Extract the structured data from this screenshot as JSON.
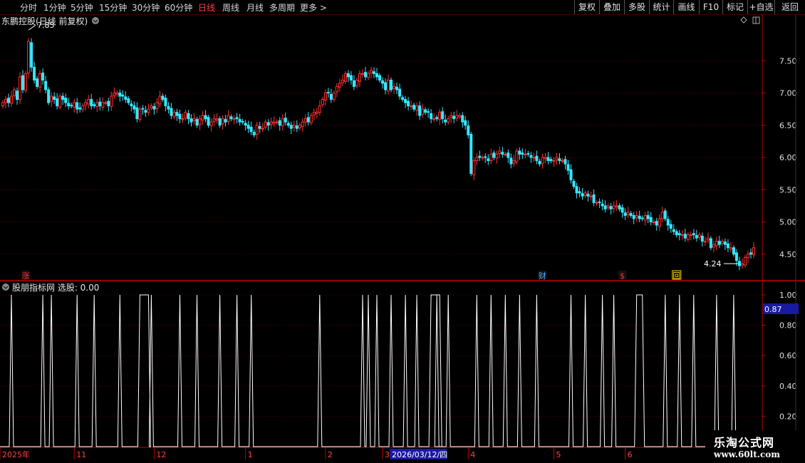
{
  "toolbar": {
    "periods": [
      {
        "label": "分时",
        "active": false
      },
      {
        "label": "1分钟",
        "active": false
      },
      {
        "label": "5分钟",
        "active": false
      },
      {
        "label": "15分钟",
        "active": false
      },
      {
        "label": "30分钟",
        "active": false
      },
      {
        "label": "60分钟",
        "active": false
      },
      {
        "label": "日线",
        "active": true
      },
      {
        "label": "周线",
        "active": false
      },
      {
        "label": "月线",
        "active": false
      },
      {
        "label": "多周期",
        "active": false
      },
      {
        "label": "更多 >",
        "active": false
      }
    ],
    "tools": [
      "复权",
      "叠加",
      "多股",
      "统计",
      "画线",
      "F10",
      "标记",
      "+自选",
      "返回"
    ]
  },
  "main_panel": {
    "title": "东鹏控股(日线 前复权)",
    "high_label": "7.85",
    "low_label": "4.24",
    "markers": [
      {
        "text": "涨",
        "color": "#ff3030",
        "at": 8
      },
      {
        "text": "财",
        "color": "#4aa8ff",
        "at": 189
      },
      {
        "text": "$",
        "color": "#ff3030",
        "at": 217
      },
      {
        "text": "回",
        "color": "#ffcc00",
        "at": 236
      }
    ],
    "price_ticks": [
      "7.50",
      "7.00",
      "6.50",
      "6.00",
      "5.50",
      "5.00",
      "4.50"
    ]
  },
  "indicator_panel": {
    "title": "股朋指标网 选股: 0.00",
    "current_value": "0.87",
    "ticks": [
      "1.00",
      "0.80",
      "0.60",
      "0.40",
      "0.20"
    ]
  },
  "date_axis": {
    "labels": [
      {
        "text": "2025年",
        "at": 0
      },
      {
        "text": "11",
        "at": 25
      },
      {
        "text": "12",
        "at": 53
      },
      {
        "text": "1",
        "at": 85
      },
      {
        "text": "2",
        "at": 113
      },
      {
        "text": "3",
        "at": 133
      },
      {
        "text": "4",
        "at": 163
      },
      {
        "text": "5",
        "at": 193
      },
      {
        "text": "6",
        "at": 218
      }
    ],
    "cursor_label": "2026/03/12/四",
    "cursor_at": 145
  },
  "colors": {
    "up": "#ff3030",
    "down": "#33e8ff",
    "accent": "#ff3030",
    "grid": "#5a0000",
    "axis": "#c00000"
  },
  "watermark": {
    "brand": "乐淘公式网",
    "url": "www.60lt.com"
  },
  "chart_data": {
    "type": "candlestick",
    "title": "东鹏控股(日线 前复权)",
    "ylim": [
      4.1,
      8.0
    ],
    "closes": [
      6.85,
      6.9,
      6.85,
      6.95,
      7.05,
      6.9,
      7.25,
      7.05,
      7.3,
      7.8,
      7.4,
      7.2,
      7.1,
      7.3,
      7.2,
      7.05,
      6.85,
      6.95,
      6.9,
      6.8,
      6.95,
      6.9,
      6.85,
      6.8,
      6.8,
      6.85,
      6.75,
      6.75,
      6.8,
      6.85,
      6.9,
      6.8,
      6.8,
      6.85,
      6.8,
      6.85,
      6.85,
      6.8,
      6.95,
      7.0,
      7.0,
      6.95,
      6.95,
      6.9,
      6.85,
      6.8,
      6.75,
      6.6,
      6.75,
      6.75,
      6.7,
      6.75,
      6.8,
      6.75,
      6.85,
      6.95,
      6.9,
      6.8,
      6.75,
      6.65,
      6.7,
      6.65,
      6.6,
      6.6,
      6.7,
      6.6,
      6.55,
      6.6,
      6.5,
      6.6,
      6.65,
      6.6,
      6.5,
      6.55,
      6.6,
      6.6,
      6.5,
      6.6,
      6.55,
      6.65,
      6.6,
      6.6,
      6.6,
      6.55,
      6.55,
      6.5,
      6.45,
      6.4,
      6.35,
      6.5,
      6.45,
      6.45,
      6.55,
      6.5,
      6.55,
      6.55,
      6.55,
      6.5,
      6.6,
      6.55,
      6.5,
      6.45,
      6.5,
      6.45,
      6.5,
      6.55,
      6.6,
      6.55,
      6.65,
      6.7,
      6.7,
      6.8,
      6.9,
      7.0,
      7.0,
      6.9,
      7.0,
      7.1,
      7.15,
      7.2,
      7.3,
      7.25,
      7.2,
      7.1,
      7.2,
      7.3,
      7.3,
      7.25,
      7.3,
      7.35,
      7.3,
      7.25,
      7.2,
      7.15,
      7.05,
      7.2,
      7.05,
      7.1,
      7.05,
      6.95,
      6.9,
      6.85,
      6.8,
      6.8,
      6.75,
      6.8,
      6.65,
      6.75,
      6.7,
      6.7,
      6.6,
      6.6,
      6.6,
      6.7,
      6.6,
      6.55,
      6.6,
      6.65,
      6.6,
      6.65,
      6.65,
      6.55,
      6.5,
      6.35,
      5.75,
      5.95,
      6.0,
      6.0,
      6.0,
      6.0,
      5.95,
      6.05,
      6.0,
      6.05,
      6.1,
      6.05,
      6.05,
      6.0,
      5.9,
      5.95,
      6.1,
      6.05,
      6.05,
      6.05,
      6.05,
      6.0,
      6.0,
      5.95,
      5.9,
      6.0,
      6.0,
      5.95,
      5.95,
      5.95,
      6.0,
      5.95,
      5.95,
      5.9,
      5.8,
      5.65,
      5.55,
      5.45,
      5.45,
      5.4,
      5.45,
      5.4,
      5.4,
      5.3,
      5.3,
      5.3,
      5.25,
      5.2,
      5.25,
      5.2,
      5.25,
      5.25,
      5.2,
      5.15,
      5.1,
      5.15,
      5.1,
      5.05,
      5.1,
      5.05,
      5.05,
      5.1,
      5.05,
      5.0,
      5.0,
      4.95,
      5.05,
      5.15,
      5.05,
      4.95,
      4.9,
      4.85,
      4.8,
      4.8,
      4.8,
      4.75,
      4.8,
      4.8,
      4.8,
      4.75,
      4.8,
      4.7,
      4.7,
      4.75,
      4.6,
      4.65,
      4.7,
      4.65,
      4.7,
      4.65,
      4.6,
      4.6,
      4.5,
      4.4,
      4.32,
      4.35,
      4.45,
      4.5,
      4.5,
      4.6
    ]
  }
}
